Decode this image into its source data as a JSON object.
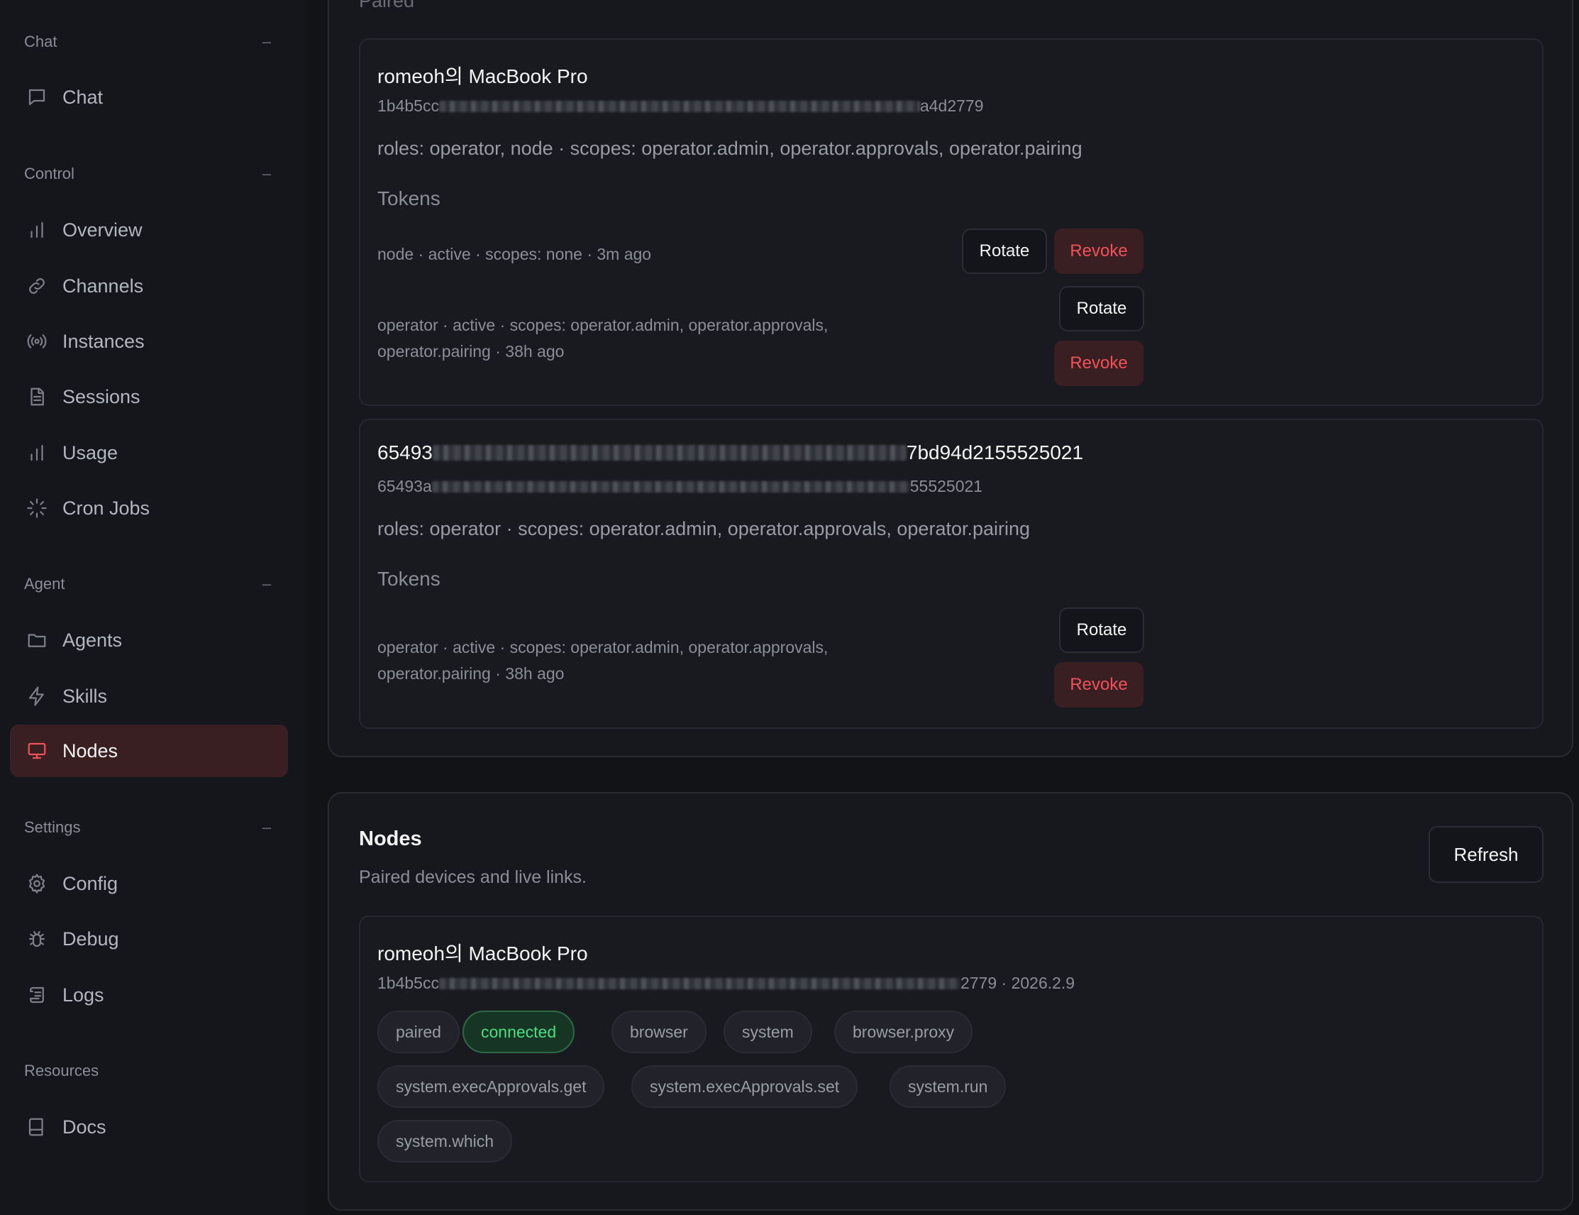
{
  "sidebar": {
    "groups": [
      {
        "label": "Chat",
        "items": [
          {
            "label": "Chat",
            "icon": "chat-bubble-icon"
          }
        ]
      },
      {
        "label": "Control",
        "items": [
          {
            "label": "Overview",
            "icon": "bar-chart-icon"
          },
          {
            "label": "Channels",
            "icon": "link-icon"
          },
          {
            "label": "Instances",
            "icon": "radio-icon"
          },
          {
            "label": "Sessions",
            "icon": "file-icon"
          },
          {
            "label": "Usage",
            "icon": "bar-chart-icon"
          },
          {
            "label": "Cron Jobs",
            "icon": "loader-icon"
          }
        ]
      },
      {
        "label": "Agent",
        "items": [
          {
            "label": "Agents",
            "icon": "folder-icon"
          },
          {
            "label": "Skills",
            "icon": "zap-icon"
          },
          {
            "label": "Nodes",
            "icon": "monitor-icon",
            "active": true
          }
        ]
      },
      {
        "label": "Settings",
        "items": [
          {
            "label": "Config",
            "icon": "gear-icon"
          },
          {
            "label": "Debug",
            "icon": "bug-icon"
          },
          {
            "label": "Logs",
            "icon": "scroll-icon"
          }
        ]
      },
      {
        "label": "Resources",
        "items": [
          {
            "label": "Docs",
            "icon": "book-icon"
          }
        ]
      }
    ],
    "collapse_glyph": "–"
  },
  "paired": {
    "heading": "Paired",
    "devices": [
      {
        "name": "romeoh의 MacBook Pro",
        "id_prefix": "1b4b5cc",
        "id_suffix": "a4d2779",
        "roles": "roles: operator, node · scopes: operator.admin, operator.approvals, operator.pairing",
        "tokens_label": "Tokens",
        "tokens": [
          {
            "line1": "node · active · scopes: none · 3m ago",
            "line2": "",
            "rotate": "Rotate",
            "revoke": "Revoke"
          },
          {
            "line1": "operator · active · scopes: operator.admin, operator.approvals,",
            "line2": "operator.pairing · 38h ago",
            "rotate": "Rotate",
            "revoke": "Revoke"
          }
        ]
      },
      {
        "name_prefix": "65493",
        "name_suffix": "7bd94d2155525021",
        "id_prefix": "65493a",
        "id_suffix": "55525021",
        "roles": "roles: operator · scopes: operator.admin, operator.approvals, operator.pairing",
        "tokens_label": "Tokens",
        "tokens": [
          {
            "line1": "operator · active · scopes: operator.admin, operator.approvals,",
            "line2": "operator.pairing · 38h ago",
            "rotate": "Rotate",
            "revoke": "Revoke"
          }
        ]
      }
    ]
  },
  "nodes": {
    "title": "Nodes",
    "subtitle": "Paired devices and live links.",
    "refresh_label": "Refresh",
    "node": {
      "name": "romeoh의 MacBook Pro",
      "id_prefix": "1b4b5cc",
      "id_suffix": "2779 · 2026.2.9",
      "chips": [
        "paired",
        "connected",
        "browser",
        "system",
        "browser.proxy",
        "system.execApprovals.get",
        "system.execApprovals.set",
        "system.run",
        "system.which"
      ],
      "status_color": "#4ade80"
    }
  },
  "colors": {
    "accent": "#f0525a",
    "background": "#121317",
    "connected": "#4ade80"
  }
}
